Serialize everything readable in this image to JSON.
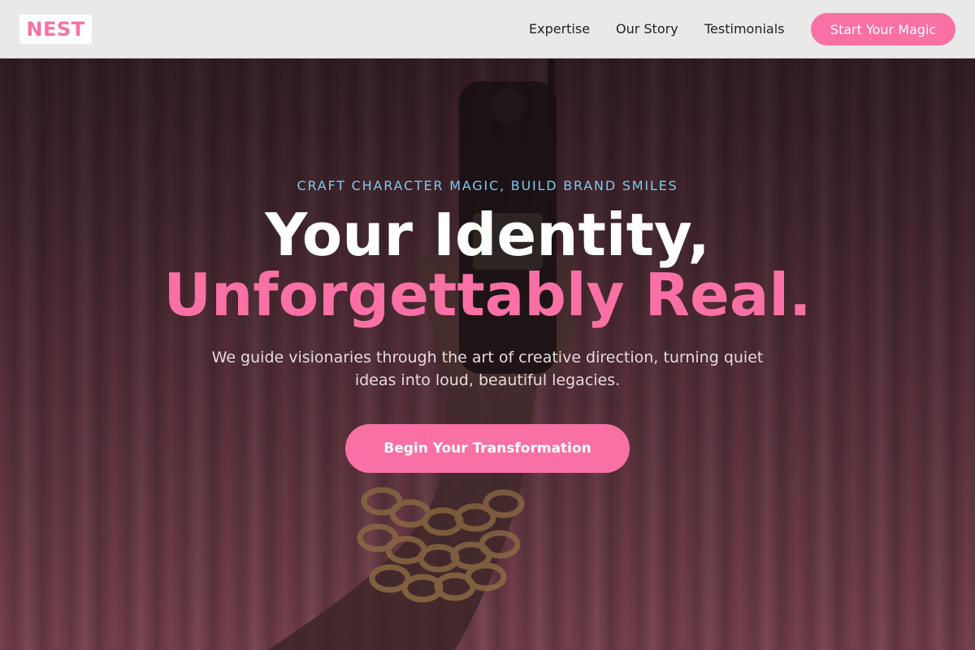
{
  "header": {
    "logo": "NEST",
    "nav": [
      "Expertise",
      "Our Story",
      "Testimonials"
    ],
    "cta_label": "Start Your Magic"
  },
  "hero": {
    "eyebrow": "CRAFT CHARACTER MAGIC, BUILD BRAND SMILES",
    "headline_line1": "Your Identity,",
    "headline_line2": "Unforgettably Real.",
    "subtext": "We guide visionaries through the art of creative direction, turning quiet ideas into loud, beautiful legacies.",
    "cta_label": "Begin Your Transformation"
  },
  "colors": {
    "accent": "#f970a4",
    "eyebrow": "#7fc8f0",
    "header_bg": "#e9e9e9"
  }
}
